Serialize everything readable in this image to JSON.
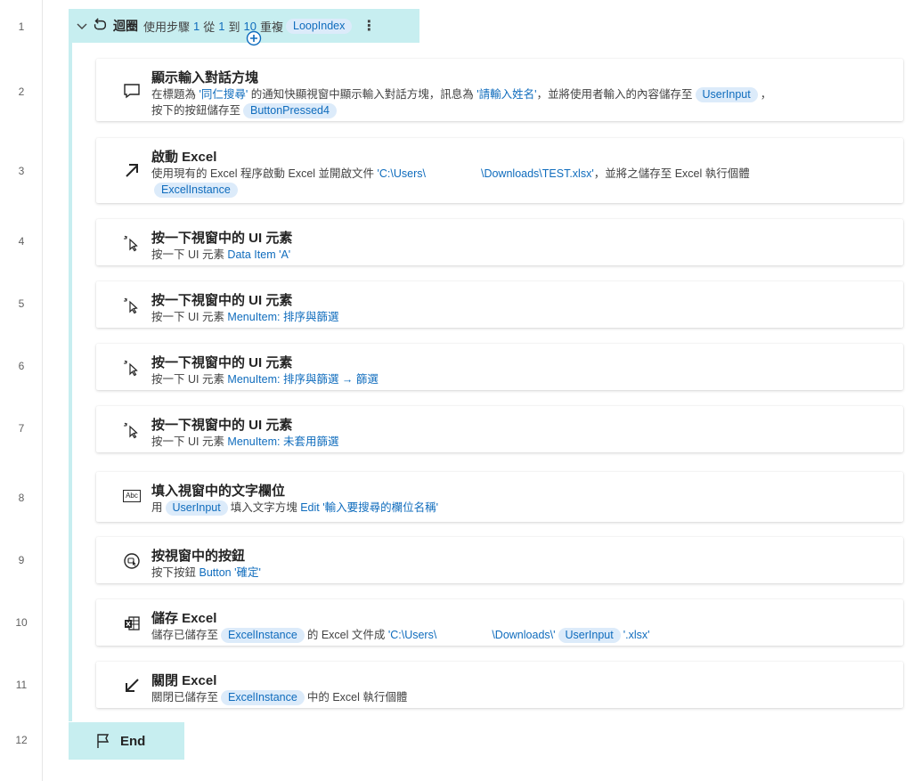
{
  "line_numbers": [
    "1",
    "2",
    "3",
    "4",
    "5",
    "6",
    "7",
    "8",
    "9",
    "10",
    "11",
    "12"
  ],
  "loop": {
    "title": "迴圈",
    "pre": "使用步驟",
    "start": "1",
    "from": "從",
    "from_val": "1",
    "to": "到",
    "to_val": "10",
    "repeat": "重複",
    "var": "LoopIndex",
    "more": "⋮"
  },
  "steps": {
    "s2": {
      "title": "顯示輸入對話方塊",
      "t1": "在標題為 ",
      "v1": "'同仁搜尋'",
      "t2": " 的通知快顯視窗中顯示輸入對話方塊，訊息為 ",
      "v2": "'請輸入姓名'",
      "t3": "，並將使用者輸入的內容儲存至",
      "p1": "UserInput",
      "t4": "，",
      "t5": "按下的按鈕儲存至",
      "p2": "ButtonPressed4"
    },
    "s3": {
      "title": "啟動 Excel",
      "t1": "使用現有的 Excel 程序啟動 Excel 並開啟文件 ",
      "v1": "'C:\\Users\\",
      "v2": "\\Downloads\\TEST.xlsx'",
      "t2": "，並將之儲存至 Excel 執行個體",
      "p1": "ExcelInstance"
    },
    "s4": {
      "title": "按一下視窗中的 UI 元素",
      "t1": "按一下 UI 元素 ",
      "v1": "Data Item 'A'"
    },
    "s5": {
      "title": "按一下視窗中的 UI 元素",
      "t1": "按一下 UI 元素 ",
      "v1": "MenuItem: 排序與篩選"
    },
    "s6": {
      "title": "按一下視窗中的 UI 元素",
      "t1": "按一下 UI 元素 ",
      "v1": "MenuItem: 排序與篩選 → 篩選"
    },
    "s7": {
      "title": "按一下視窗中的 UI 元素",
      "t1": "按一下 UI 元素 ",
      "v1": "MenuItem: 未套用篩選"
    },
    "s8": {
      "title": "填入視窗中的文字欄位",
      "t1": "用",
      "p1": "UserInput",
      "t2": "填入文字方塊 ",
      "v1": "Edit '輸入要搜尋的欄位名稱'",
      "icon_text": "Abc"
    },
    "s9": {
      "title": "按視窗中的按鈕",
      "t1": "按下按鈕 ",
      "v1": "Button '確定'"
    },
    "s10": {
      "title": "儲存 Excel",
      "t1": "儲存已儲存至",
      "p1": "ExcelInstance",
      "t2": "的 Excel 文件成 ",
      "v1": "'C:\\Users\\",
      "v2": "\\Downloads\\'",
      "p2": "UserInput",
      "v3": "'.xlsx'"
    },
    "s11": {
      "title": "關閉 Excel",
      "t1": "關閉已儲存至",
      "p1": "ExcelInstance",
      "t2": "中的 Excel 執行個體"
    }
  },
  "end": {
    "label": "End"
  },
  "colors": {
    "accent": "#0f6cbd",
    "loop_bg": "#c7eef0",
    "pill_bg": "#dcebfa"
  },
  "icons": {
    "s2": "message-icon",
    "s3": "launch-arrow-icon",
    "s4": "click-icon",
    "s5": "click-icon",
    "s6": "click-icon",
    "s7": "click-icon",
    "s8": "textbox-icon",
    "s9": "press-button-icon",
    "s10": "excel-save-icon",
    "s11": "close-arrow-icon",
    "loop": "loop-icon",
    "end": "flag-icon"
  }
}
